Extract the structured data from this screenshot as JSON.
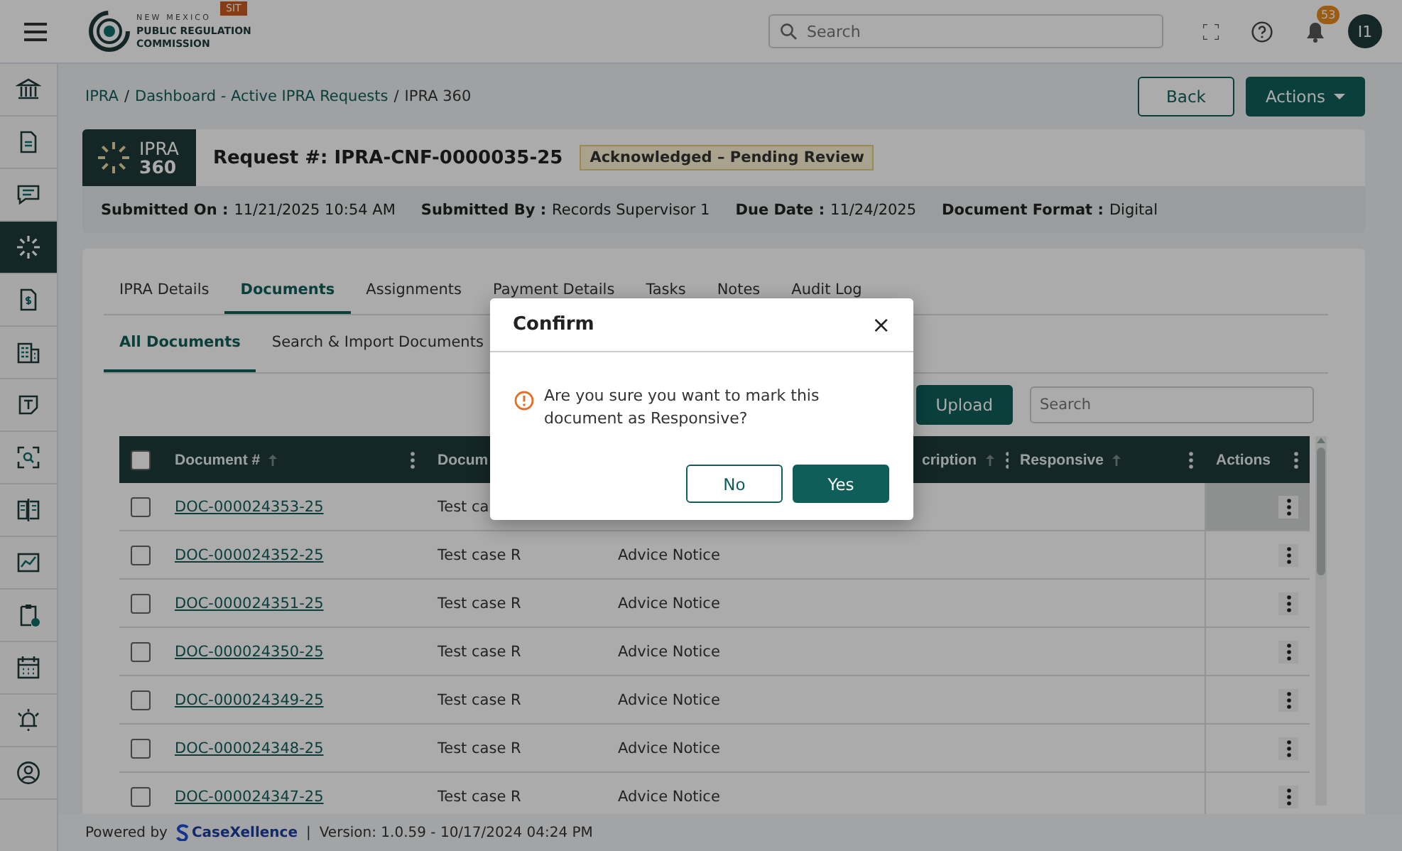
{
  "header": {
    "logo": {
      "line1": "NEW MEXICO",
      "line2": "PUBLIC REGULATION",
      "line3": "COMMISSION"
    },
    "env_badge": "SIT",
    "search": {
      "placeholder": "Search"
    },
    "notifications": {
      "count": "53"
    },
    "avatar": "I1"
  },
  "sidebar": {
    "items": [
      {
        "selected": false
      },
      {
        "selected": false
      },
      {
        "selected": false
      },
      {
        "selected": true
      },
      {
        "selected": false
      },
      {
        "selected": false
      },
      {
        "selected": false
      },
      {
        "selected": false
      },
      {
        "selected": false
      },
      {
        "selected": false
      },
      {
        "selected": false
      },
      {
        "selected": false
      },
      {
        "selected": false
      },
      {
        "selected": false
      }
    ]
  },
  "breadcrumb": {
    "separator": "/",
    "items": [
      {
        "label": "IPRA",
        "link": true
      },
      {
        "label": "Dashboard - Active IPRA Requests",
        "link": true
      },
      {
        "label": "IPRA 360",
        "link": false
      }
    ]
  },
  "page_buttons": [
    {
      "label": "Back",
      "kind": "outline"
    },
    {
      "label": "Actions",
      "kind": "dropdown"
    }
  ],
  "request": {
    "badge_line1": "IPRA",
    "badge_line2": "360",
    "title": "Request #: IPRA-CNF-0000035-25",
    "status": "Acknowledged – Pending Review",
    "details": [
      {
        "label": "Submitted On :",
        "value": "11/21/2025 10:54 AM"
      },
      {
        "label": "Submitted By :",
        "value": "Records Supervisor 1"
      },
      {
        "label": "Due Date :",
        "value": "11/24/2025"
      },
      {
        "label": "Document Format :",
        "value": "Digital"
      }
    ]
  },
  "tabs": [
    {
      "label": "IPRA Details",
      "selected": false
    },
    {
      "label": "Documents",
      "selected": true
    },
    {
      "label": "Assignments",
      "selected": false
    },
    {
      "label": "Payment Details",
      "selected": false
    },
    {
      "label": "Tasks",
      "selected": false
    },
    {
      "label": "Notes",
      "selected": false
    },
    {
      "label": "Audit Log",
      "selected": false
    }
  ],
  "subtabs": [
    {
      "label": "All Documents",
      "selected": true
    },
    {
      "label": "Search & Import Documents",
      "selected": false
    }
  ],
  "toolbar": {
    "upload": "Upload",
    "search": {
      "placeholder": "Search"
    }
  },
  "table": {
    "select_all": {
      "checked": false
    },
    "columns": [
      {
        "label": "Document #",
        "sort": true,
        "menu": true
      },
      {
        "label": "Docum"
      },
      {
        "label": "cription",
        "sort": true,
        "menu": true
      },
      {
        "label": "Responsive",
        "sort": true,
        "menu": true
      },
      {
        "label": "Actions",
        "sort": false,
        "menu": true
      }
    ],
    "rows": [
      {
        "checked": false,
        "hover": true,
        "document_no": "DOC-000024353-25",
        "column_2": "Test ca"
      },
      {
        "checked": false,
        "hover": false,
        "document_no": "DOC-000024352-25",
        "column_2": "Test case R",
        "column_3": "Advice Notice"
      },
      {
        "checked": false,
        "hover": false,
        "document_no": "DOC-000024351-25",
        "column_2": "Test case R",
        "column_3": "Advice Notice"
      },
      {
        "checked": false,
        "hover": false,
        "document_no": "DOC-000024350-25",
        "column_2": "Test case R",
        "column_3": "Advice Notice"
      },
      {
        "checked": false,
        "hover": false,
        "document_no": "DOC-000024349-25",
        "column_2": "Test case R",
        "column_3": "Advice Notice"
      },
      {
        "checked": false,
        "hover": false,
        "document_no": "DOC-000024348-25",
        "column_2": "Test case R",
        "column_3": "Advice Notice"
      },
      {
        "checked": false,
        "hover": false,
        "document_no": "DOC-000024347-25",
        "column_2": "Test case R",
        "column_3": "Advice Notice"
      }
    ]
  },
  "footer": {
    "powered_by": "Powered by",
    "brand": "CaseXellence",
    "separator": "|",
    "version": "Version: 1.0.59 - 10/17/2024 04:24 PM"
  },
  "modal": {
    "title": "Confirm",
    "close": "×",
    "message": "Are you sure you want to mark this document as Responsive?",
    "buttons": [
      {
        "label": "No",
        "kind": "secondary"
      },
      {
        "label": "Yes",
        "kind": "primary"
      }
    ]
  }
}
